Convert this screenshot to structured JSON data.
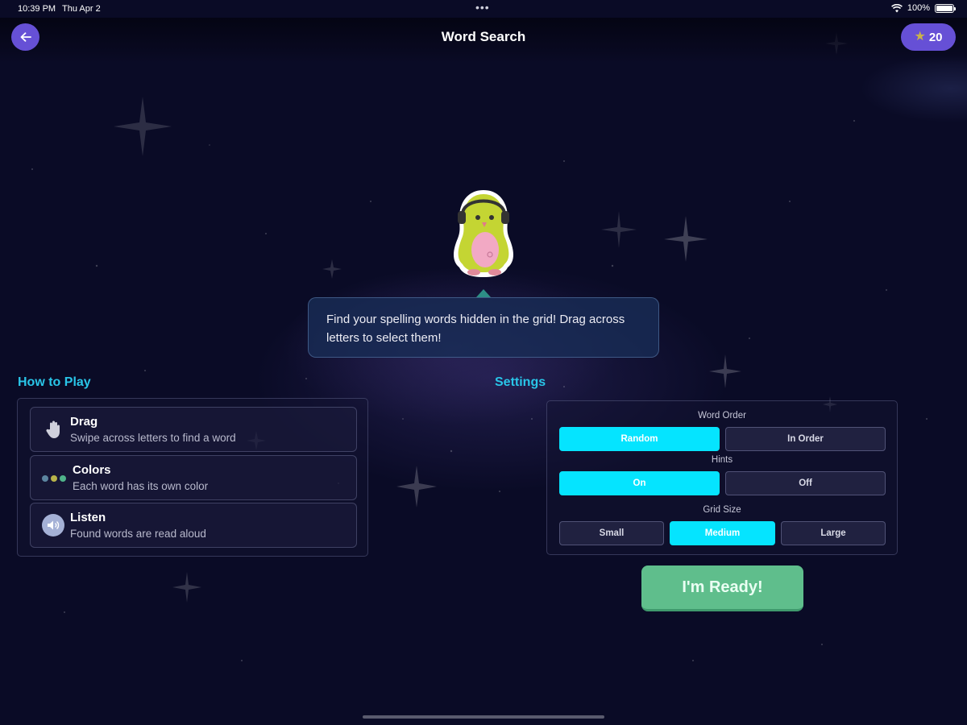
{
  "status_bar": {
    "time": "10:39 PM",
    "date": "Thu Apr 2",
    "dots": "•••",
    "battery": "100%"
  },
  "header": {
    "title": "Word Search",
    "stars": "20",
    "back_icon": "arrow-left-icon",
    "star_icon": "star-icon"
  },
  "instructions": "Find your spelling words hidden in the grid! Drag across letters to select them!",
  "how_to_play": {
    "heading": "How to Play",
    "items": [
      {
        "title": "Drag",
        "description": "Swipe across letters to find a word",
        "icon": "hand-icon"
      },
      {
        "title": "Colors",
        "description": "Each word has its own color",
        "icon": "color-dots-icon"
      },
      {
        "title": "Listen",
        "description": "Found words are read aloud",
        "icon": "speaker-icon"
      }
    ]
  },
  "settings": {
    "heading": "Settings",
    "word_order": {
      "label": "Word Order",
      "options": [
        "Random",
        "In Order"
      ],
      "selected": "Random"
    },
    "hints": {
      "label": "Hints",
      "options": [
        "On",
        "Off"
      ],
      "selected": "On"
    },
    "grid_size": {
      "label": "Grid Size",
      "options": [
        "Small",
        "Medium",
        "Large"
      ],
      "selected": "Medium"
    }
  },
  "ready_button": "I'm Ready!",
  "colors": {
    "accent": "#6650d6",
    "heading": "#29c5e8",
    "selected_option": "#05e4ff",
    "ready": "#5fbe8c",
    "background": "#0a0b26"
  }
}
